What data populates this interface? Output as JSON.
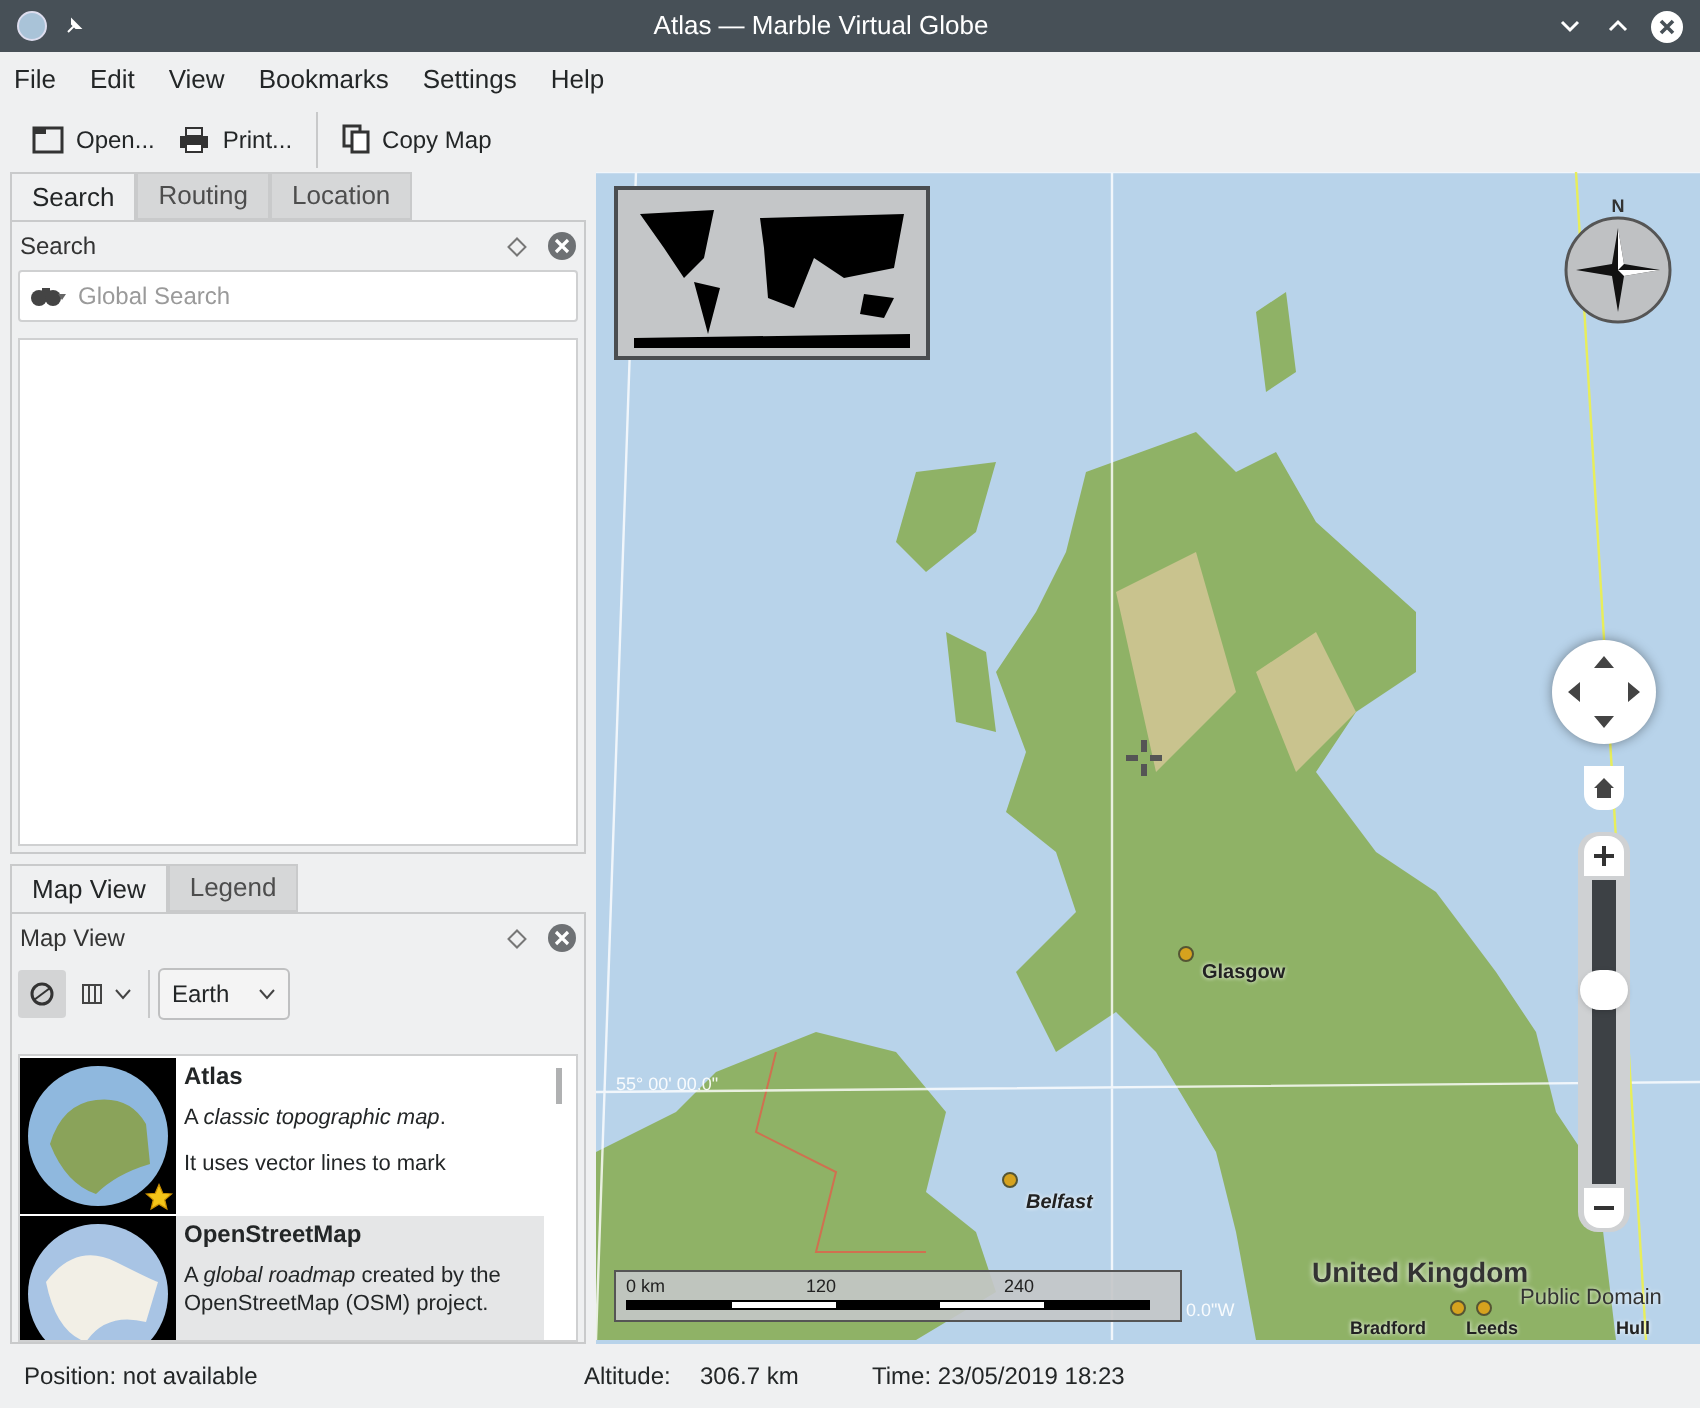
{
  "window": {
    "title": "Atlas — Marble Virtual Globe"
  },
  "menu": [
    "File",
    "Edit",
    "View",
    "Bookmarks",
    "Settings",
    "Help"
  ],
  "toolbar": [
    {
      "label": "Open...",
      "kind": "open"
    },
    {
      "label": "Print...",
      "kind": "print"
    },
    {
      "label": "Copy Map",
      "kind": "copy"
    }
  ],
  "upper_tabs": [
    {
      "label": "Search",
      "selected": true
    },
    {
      "label": "Routing",
      "selected": false
    },
    {
      "label": "Location",
      "selected": false
    }
  ],
  "search_dock": {
    "title": "Search",
    "placeholder": "Global Search"
  },
  "lower_tabs": [
    {
      "label": "Map View",
      "selected": true
    },
    {
      "label": "Legend",
      "selected": false
    }
  ],
  "map_view_dock": {
    "title": "Map View",
    "planet": "Earth"
  },
  "themes": [
    {
      "title": "Atlas",
      "description": "A *classic topographic map*.",
      "more": "It uses vector lines to mark",
      "favorite": true,
      "selected": false,
      "kind": "atlas"
    },
    {
      "title": "OpenStreetMap",
      "description": "A *global roadmap* created by the OpenStreetMap (OSM) project.",
      "favorite": false,
      "selected": true,
      "kind": "osm"
    }
  ],
  "map": {
    "labels": [
      {
        "text": "Glasgow",
        "kind": "city"
      },
      {
        "text": "Belfast",
        "kind": "city-italic"
      },
      {
        "text": "United Kingdom",
        "kind": "country"
      },
      {
        "text": "Bradford",
        "kind": "city-partial"
      },
      {
        "text": "Leeds",
        "kind": "city-partial"
      },
      {
        "text": "Hull",
        "kind": "city-partial"
      },
      {
        "text": "55° 00' 00.0\"",
        "kind": "grid"
      },
      {
        "text": "0.0\"W",
        "kind": "grid"
      },
      {
        "text": "Public Domain",
        "kind": "attribution"
      }
    ],
    "compass_label": "N",
    "scale": [
      "0 km",
      "120",
      "240"
    ],
    "zoom": {
      "level": 0.64
    }
  },
  "status_bar": [
    "Position: not available",
    "Altitude:",
    "306.7 km",
    "Time: 23/05/2019 18:23"
  ]
}
